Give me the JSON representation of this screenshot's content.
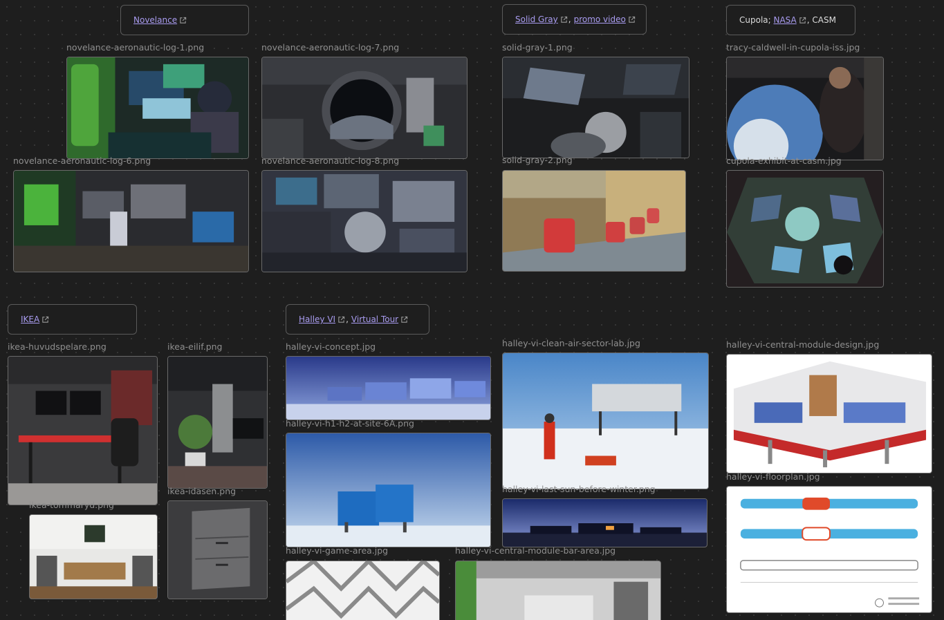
{
  "cards": [
    {
      "id": "novelance",
      "links": [
        {
          "label": "Novelance"
        }
      ]
    },
    {
      "id": "solid-gray",
      "links": [
        {
          "label": "Solid Gray"
        },
        {
          "label": "promo video"
        }
      ]
    },
    {
      "id": "cupola",
      "prefix": "Cupola; ",
      "links": [
        {
          "label": "NASA"
        }
      ],
      "suffix": ", CASM"
    },
    {
      "id": "ikea",
      "links": [
        {
          "label": "IKEA"
        }
      ]
    },
    {
      "id": "halley",
      "links": [
        {
          "label": "Halley VI"
        },
        {
          "label": "Virtual Tour"
        }
      ]
    }
  ],
  "images": [
    {
      "file": "novelance-aeronautic-log-1.png"
    },
    {
      "file": "novelance-aeronautic-log-7.png"
    },
    {
      "file": "novelance-aeronautic-log-6.png"
    },
    {
      "file": "novelance-aeronautic-log-8.png"
    },
    {
      "file": "solid-gray-1.png"
    },
    {
      "file": "solid-gray-2.png"
    },
    {
      "file": "tracy-caldwell-in-cupola-iss.jpg"
    },
    {
      "file": "cupola-exhibit-at-casm.jpg"
    },
    {
      "file": "ikea-huvudspelare.png"
    },
    {
      "file": "ikea-eilif.png"
    },
    {
      "file": "ikea-idasen.png"
    },
    {
      "file": "ikea-tommaryd.png"
    },
    {
      "file": "halley-vi-concept.jpg"
    },
    {
      "file": "halley-vi-h1-h2-at-site-6A.png"
    },
    {
      "file": "halley-vi-game-area.jpg"
    },
    {
      "file": "halley-vi-clean-air-sector-lab.jpg"
    },
    {
      "file": "halley-vi-last-sun-before-winter.png"
    },
    {
      "file": "halley-vi-central-module-bar-area.jpg"
    },
    {
      "file": "halley-vi-central-module-design.jpg"
    },
    {
      "file": "halley-vi-floorplan.jpg"
    }
  ],
  "colors": {
    "link": "#a99cf0",
    "card_border": "#5b5b5b",
    "canvas": "#1e1e1e",
    "caption": "#8f8f8f"
  },
  "icons": {
    "external_link": "external-link-icon"
  }
}
